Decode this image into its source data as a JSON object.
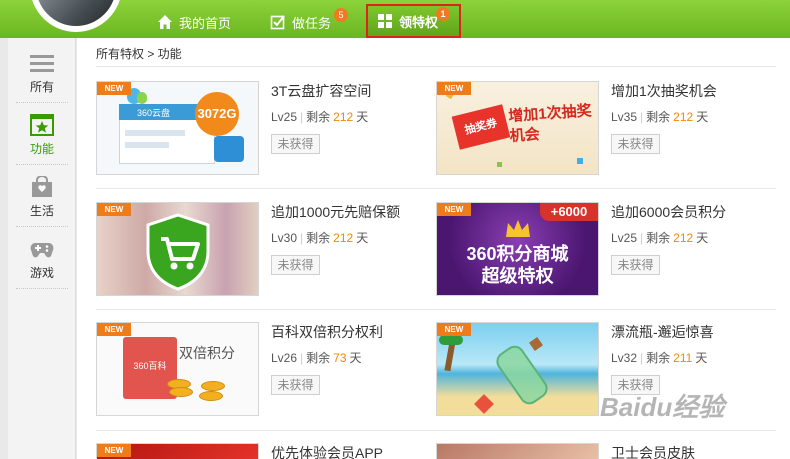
{
  "nav": {
    "home": "我的首页",
    "tasks": "做任务",
    "tasks_badge": "5",
    "privileges": "领特权",
    "privileges_badge": "1"
  },
  "sidebar": {
    "items": [
      {
        "label": "所有",
        "icon": "list-icon"
      },
      {
        "label": "功能",
        "icon": "star-icon"
      },
      {
        "label": "生活",
        "icon": "bag-icon"
      },
      {
        "label": "游戏",
        "icon": "gamepad-icon"
      }
    ],
    "active": "功能"
  },
  "breadcrumb": "所有特权 > 功能",
  "new_tag": "NEW",
  "cards": [
    {
      "title": "3T云盘扩容空间",
      "level": "Lv25",
      "remain": "剩余",
      "days": "212",
      "unit": "天",
      "status": "未获得",
      "art_text": "3072G",
      "art_sub": "360云盘"
    },
    {
      "title": "增加1次抽奖机会",
      "level": "Lv35",
      "remain": "剩余",
      "days": "212",
      "unit": "天",
      "status": "未获得",
      "art_text": "增加1次抽奖机会",
      "art_sub": "抽奖券"
    },
    {
      "title": "追加1000元先赔保额",
      "level": "Lv30",
      "remain": "剩余",
      "days": "212",
      "unit": "天",
      "status": "未获得"
    },
    {
      "title": "追加6000会员积分",
      "level": "Lv25",
      "remain": "剩余",
      "days": "212",
      "unit": "天",
      "status": "未获得",
      "art_text": "360积分商城",
      "art_sub": "超级特权",
      "art_badge": "+6000"
    },
    {
      "title": "百科双倍积分权利",
      "level": "Lv26",
      "remain": "剩余",
      "days": "73",
      "unit": "天",
      "status": "未获得",
      "art_text": "双倍积分",
      "art_sub": "360百科"
    },
    {
      "title": "漂流瓶-邂逅惊喜",
      "level": "Lv32",
      "remain": "剩余",
      "days": "211",
      "unit": "天",
      "status": "未获得"
    },
    {
      "title": "优先体验会员APP"
    },
    {
      "title": "卫士会员皮肤"
    }
  ],
  "watermark": "Baidu经验",
  "colors": {
    "accent": "#6bb61f",
    "days": "#f08a00",
    "new_tag": "#ee7c1a",
    "highlight": "#d9251c"
  }
}
